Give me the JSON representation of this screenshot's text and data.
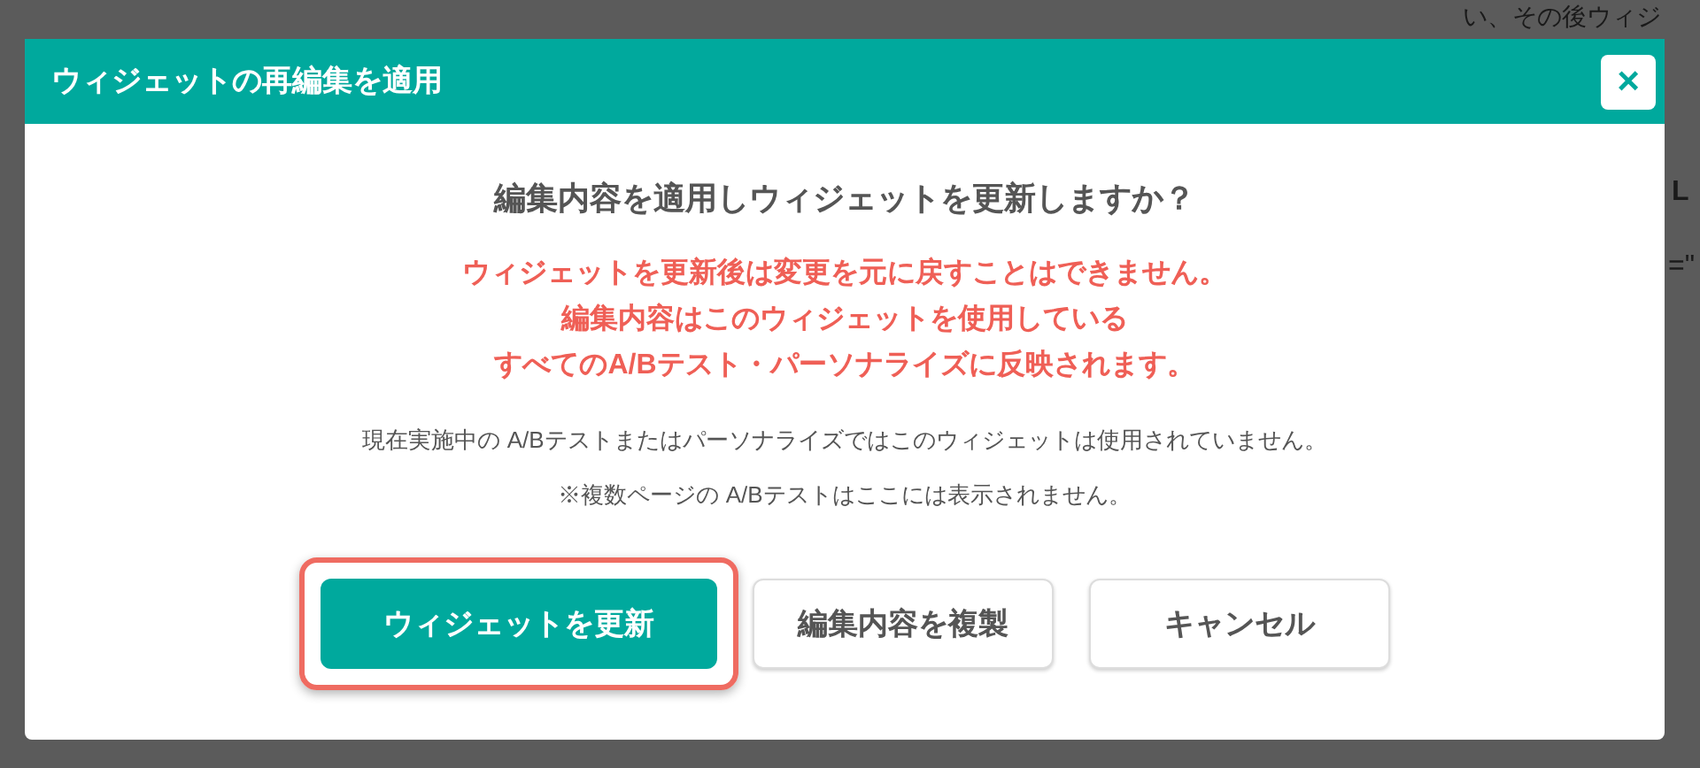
{
  "background": {
    "top_right": "い、その後ウィジ",
    "right_1": "L",
    "right_2": "=\""
  },
  "dialog": {
    "title": "ウィジェットの再編集を適用",
    "close": "×",
    "question": "編集内容を適用しウィジェットを更新しますか？",
    "warnings": [
      "ウィジェットを更新後は変更を元に戻すことはできません。",
      "編集内容はこのウィジェットを使用している",
      "すべてのA/Bテスト・パーソナライズに反映されます。"
    ],
    "notes": [
      "現在実施中の A/Bテストまたはパーソナライズではこのウィジェットは使用されていません。",
      "※複数ページの A/Bテストはここには表示されません。"
    ],
    "buttons": [
      {
        "label": "ウィジェットを更新",
        "kind": "primary",
        "focused": true
      },
      {
        "label": "編集内容を複製",
        "kind": "secondary",
        "focused": false
      },
      {
        "label": "キャンセル",
        "kind": "secondary",
        "focused": false
      }
    ]
  }
}
